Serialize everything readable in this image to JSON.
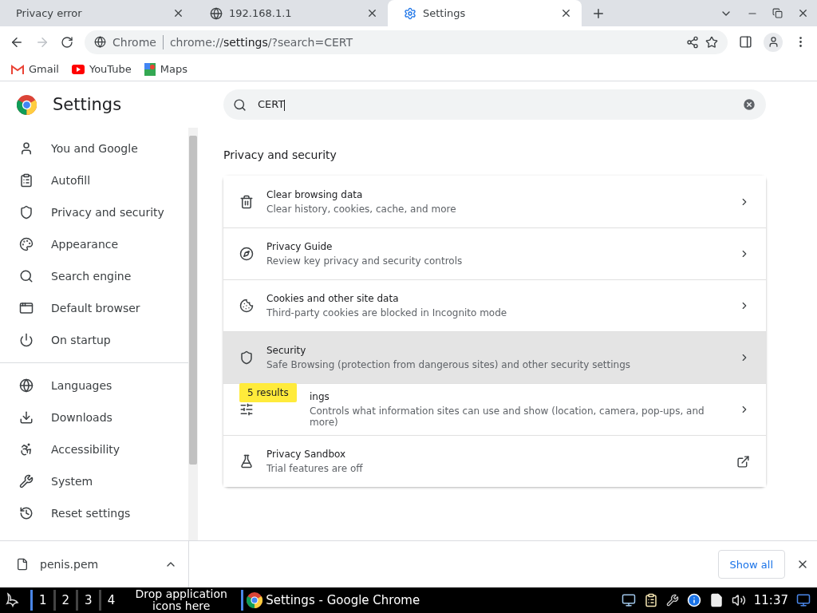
{
  "tabs": [
    {
      "title": "Privacy error",
      "kind": "plain",
      "selected": false
    },
    {
      "title": "192.168.1.1",
      "kind": "globe",
      "selected": false
    },
    {
      "title": "Settings",
      "kind": "gear",
      "selected": true
    }
  ],
  "omnibox": {
    "site": "Chrome",
    "url_prefix": "chrome://",
    "url_host": "settings",
    "url_rest": "/?search=CERT"
  },
  "bookmarks": [
    {
      "label": "Gmail",
      "kind": "gmail"
    },
    {
      "label": "YouTube",
      "kind": "youtube"
    },
    {
      "label": "Maps",
      "kind": "maps"
    }
  ],
  "settings_title": "Settings",
  "search": {
    "value": "CERT"
  },
  "sidebar": {
    "groups": [
      [
        {
          "label": "You and Google",
          "kind": "person"
        },
        {
          "label": "Autofill",
          "kind": "clipboard"
        },
        {
          "label": "Privacy and security",
          "kind": "shield"
        },
        {
          "label": "Appearance",
          "kind": "palette"
        },
        {
          "label": "Search engine",
          "kind": "search"
        },
        {
          "label": "Default browser",
          "kind": "browser"
        },
        {
          "label": "On startup",
          "kind": "power"
        }
      ],
      [
        {
          "label": "Languages",
          "kind": "globe"
        },
        {
          "label": "Downloads",
          "kind": "download"
        },
        {
          "label": "Accessibility",
          "kind": "accessibility"
        },
        {
          "label": "System",
          "kind": "wrench"
        },
        {
          "label": "Reset settings",
          "kind": "reset"
        }
      ]
    ]
  },
  "section_title": "Privacy and security",
  "rows": [
    {
      "title": "Clear browsing data",
      "subtitle": "Clear history, cookies, cache, and more",
      "kind": "trash",
      "external": false,
      "highlighted": false
    },
    {
      "title": "Privacy Guide",
      "subtitle": "Review key privacy and security controls",
      "kind": "guide",
      "external": false,
      "highlighted": false
    },
    {
      "title": "Cookies and other site data",
      "subtitle": "Third-party cookies are blocked in Incognito mode",
      "kind": "cookie",
      "external": false,
      "highlighted": false
    },
    {
      "title": "Security",
      "subtitle": "Safe Browsing (protection from dangerous sites) and other security settings",
      "kind": "shield",
      "external": false,
      "highlighted": true
    },
    {
      "title": "ings",
      "subtitle": "Controls what information sites can use and show (location, camera, pop-ups, and more)",
      "kind": "sliders",
      "external": false,
      "highlighted": false,
      "tooltip": "5 results"
    },
    {
      "title": "Privacy Sandbox",
      "subtitle": "Trial features are off",
      "kind": "flask",
      "external": true,
      "highlighted": false
    }
  ],
  "download": {
    "filename": "penis.pem",
    "button": "Show all"
  },
  "taskbar": {
    "workspaces": [
      "1",
      "2",
      "3",
      "4"
    ],
    "drop_hint": "Drop application icons here",
    "window": "Settings - Google Chrome",
    "clock": "11:37"
  }
}
